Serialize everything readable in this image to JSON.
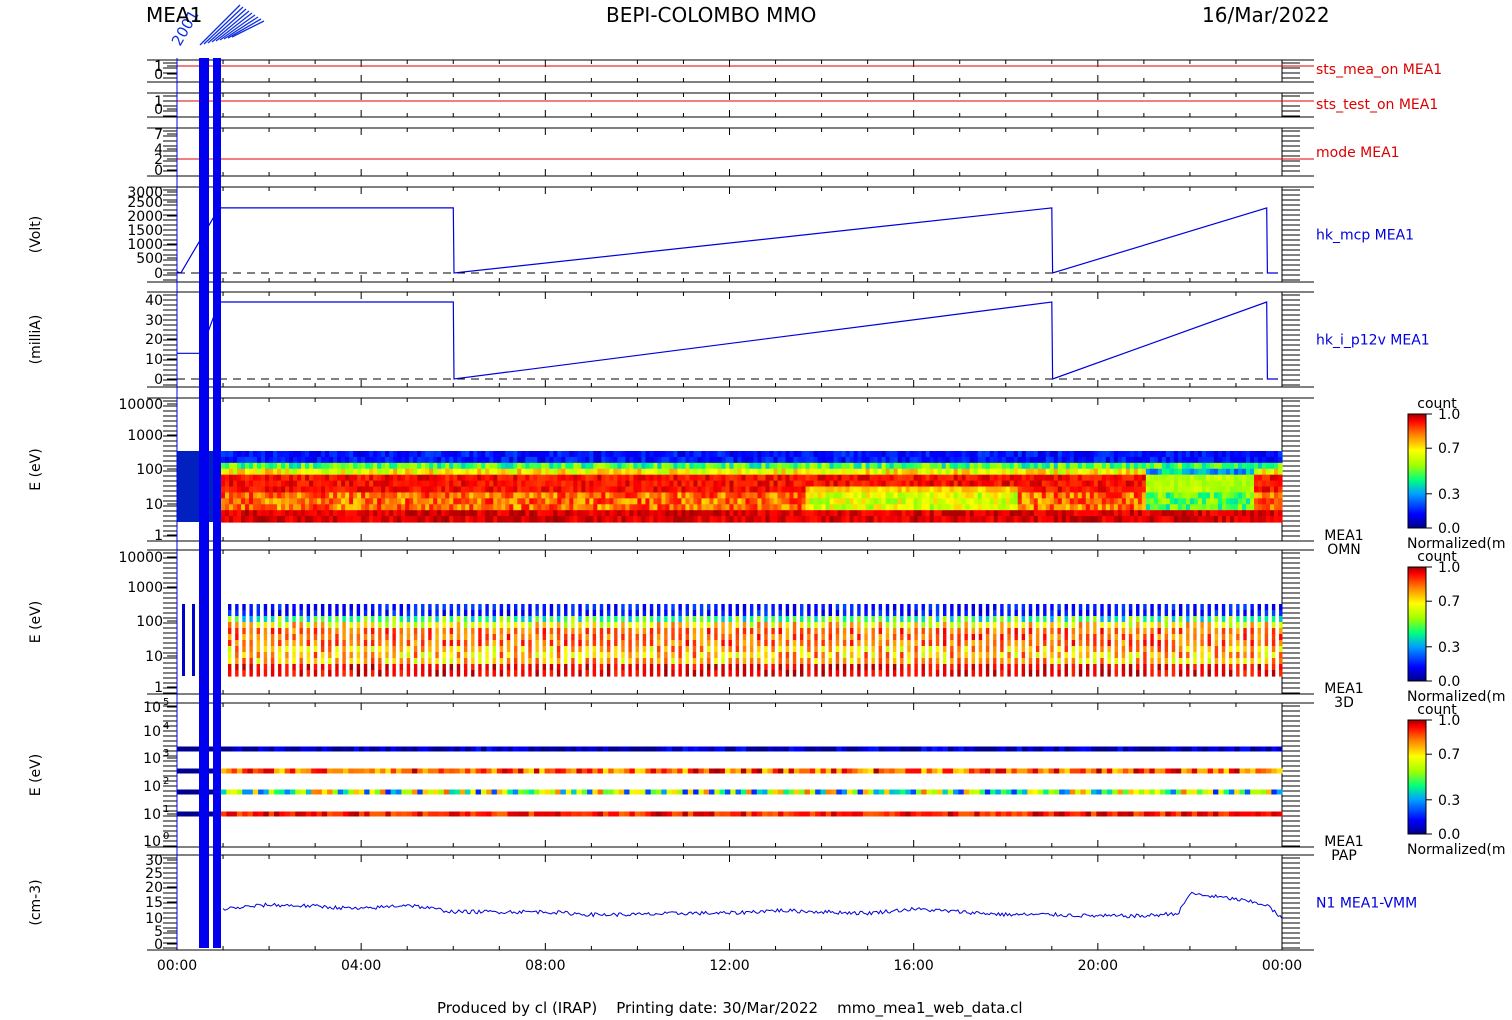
{
  "header": {
    "left": "MEA1",
    "center": "BEPI-COLOMBO MMO",
    "right": "16/Mar/2022"
  },
  "footer": "Produced by cl (IRAP)    Printing date: 30/Mar/2022    mmo_mea1_web_data.cl",
  "x_ticks": [
    "00:00",
    "04:00",
    "08:00",
    "12:00",
    "16:00",
    "20:00",
    "00:00"
  ],
  "colors": {
    "red": "#dd0000",
    "blue": "#0000dd",
    "black": "#000000"
  },
  "colorbar": {
    "title": "count",
    "ticks": [
      "1.0",
      "0.7",
      "0.3",
      "0.0"
    ],
    "label": "Normalized(m"
  },
  "panels": [
    {
      "id": "sts_mea_on",
      "label": "sts_mea_on MEA1",
      "ylabel": "",
      "ticks": [
        "1",
        "0"
      ],
      "color": "#dd0000"
    },
    {
      "id": "sts_test_on",
      "label": "sts_test_on MEA1",
      "ylabel": "",
      "ticks": [
        "1",
        "0"
      ],
      "color": "#dd0000"
    },
    {
      "id": "mode",
      "label": "mode MEA1",
      "ylabel": "",
      "ticks": [
        "7",
        "4",
        "2",
        "0"
      ],
      "color": "#dd0000"
    },
    {
      "id": "hk_mcp",
      "label": "hk_mcp MEA1",
      "ylabel": "(Volt)",
      "ticks": [
        "3000",
        "2500",
        "2000",
        "1500",
        "1000",
        "500",
        "0"
      ],
      "color": "#0000dd"
    },
    {
      "id": "hk_i_p12v",
      "label": "hk_i_p12v MEA1",
      "ylabel": "(milliA)",
      "ticks": [
        "40",
        "30",
        "20",
        "10",
        "0"
      ],
      "color": "#0000dd"
    },
    {
      "id": "omn",
      "label": "MEA1",
      "label2": "OMN",
      "ylabel": "E (eV)",
      "ticks": [
        "10000",
        "1000",
        "100",
        "10",
        "1"
      ],
      "color": "#000000"
    },
    {
      "id": "3d",
      "label": "MEA1",
      "label2": "3D",
      "ylabel": "E (eV)",
      "ticks": [
        "10000",
        "1000",
        "100",
        "10",
        "1"
      ],
      "color": "#000000"
    },
    {
      "id": "pap",
      "label": "MEA1",
      "label2": "PAP",
      "ylabel": "E (eV)",
      "ticks": [
        "10",
        "10",
        "10",
        "10",
        "10",
        "10"
      ],
      "tick_exp": [
        "5",
        "4",
        "3",
        "2",
        "1",
        "0"
      ],
      "color": "#000000"
    },
    {
      "id": "n1",
      "label": "N1 MEA1-VMM",
      "ylabel": "(cm-3)",
      "ticks": [
        "30",
        "25",
        "20",
        "15",
        "10",
        "5",
        "0"
      ],
      "color": "#0000dd"
    }
  ],
  "chart_data": [
    {
      "type": "line",
      "title": "sts_mea_on MEA1",
      "xlabel": "",
      "ylabel": "",
      "ylim": [
        0,
        1
      ],
      "x": [
        "00:00",
        "24:00"
      ],
      "series": [
        {
          "name": "sts_mea_on MEA1",
          "values": [
            1,
            1
          ]
        }
      ]
    },
    {
      "type": "line",
      "title": "sts_test_on MEA1",
      "xlabel": "",
      "ylabel": "",
      "ylim": [
        0,
        1
      ],
      "x": [
        "00:00",
        "24:00"
      ],
      "series": [
        {
          "name": "sts_test_on MEA1",
          "values": [
            1,
            1
          ]
        }
      ]
    },
    {
      "type": "line",
      "title": "mode MEA1",
      "xlabel": "",
      "ylabel": "",
      "ylim": [
        0,
        7
      ],
      "x": [
        "00:00",
        "24:00"
      ],
      "series": [
        {
          "name": "mode MEA1",
          "values": [
            2,
            2
          ]
        }
      ]
    },
    {
      "type": "line",
      "title": "hk_mcp MEA1",
      "xlabel": "",
      "ylabel": "(Volt)",
      "ylim": [
        0,
        3000
      ],
      "x": [
        "00:00",
        "00:05",
        "00:55",
        "06:00",
        "06:01",
        "19:00",
        "19:01",
        "23:40",
        "23:41",
        "24:00"
      ],
      "series": [
        {
          "name": "hk_mcp MEA1",
          "values": [
            50,
            0,
            2750,
            2750,
            0,
            2750,
            0,
            2750,
            0,
            0
          ]
        }
      ]
    },
    {
      "type": "line",
      "title": "hk_i_p12v MEA1",
      "xlabel": "",
      "ylabel": "(milliA)",
      "ylim": [
        0,
        40
      ],
      "x": [
        "00:00",
        "00:30",
        "00:55",
        "06:00",
        "06:01",
        "19:00",
        "19:01",
        "23:40",
        "23:41",
        "24:00"
      ],
      "series": [
        {
          "name": "hk_i_p12v MEA1",
          "values": [
            13,
            13,
            39,
            39,
            0,
            39,
            0,
            39,
            0,
            0
          ]
        }
      ]
    },
    {
      "type": "heatmap",
      "title": "MEA1 OMN",
      "xlabel": "",
      "ylabel": "E (eV)",
      "yscale": "log",
      "ylim": [
        1,
        10000
      ],
      "energy_range": [
        3,
        300
      ],
      "colorbar": [
        0,
        1
      ]
    },
    {
      "type": "heatmap",
      "title": "MEA1 3D",
      "xlabel": "",
      "ylabel": "E (eV)",
      "yscale": "log",
      "ylim": [
        1,
        10000
      ],
      "energy_range": [
        3,
        300
      ],
      "colorbar": [
        0,
        1
      ]
    },
    {
      "type": "heatmap",
      "title": "MEA1 PAP",
      "xlabel": "",
      "ylabel": "E (eV)",
      "yscale": "log",
      "ylim": [
        1,
        100000
      ],
      "energy_bands": [
        2000,
        400,
        70,
        10
      ],
      "colorbar": [
        0,
        1
      ]
    },
    {
      "type": "line",
      "title": "N1 MEA1-VMM",
      "xlabel": "",
      "ylabel": "(cm-3)",
      "ylim": [
        0,
        30
      ],
      "x": [
        "01:00",
        "02:00",
        "03:00",
        "04:00",
        "05:00",
        "06:00",
        "07:00",
        "08:00",
        "09:00",
        "10:00",
        "11:00",
        "12:00",
        "13:00",
        "14:00",
        "15:00",
        "16:00",
        "17:00",
        "18:00",
        "19:00",
        "20:00",
        "21:00",
        "21:45",
        "22:00",
        "23:00",
        "23:40",
        "24:00"
      ],
      "series": [
        {
          "name": "N1 MEA1-VMM",
          "values": [
            12.5,
            14,
            13.5,
            12.5,
            14,
            11.5,
            11.5,
            11.5,
            10.5,
            10.5,
            11,
            11,
            12,
            11.5,
            11,
            12.5,
            11.5,
            10.5,
            10.5,
            10,
            10,
            11,
            18,
            16,
            14,
            9
          ]
        }
      ]
    }
  ]
}
